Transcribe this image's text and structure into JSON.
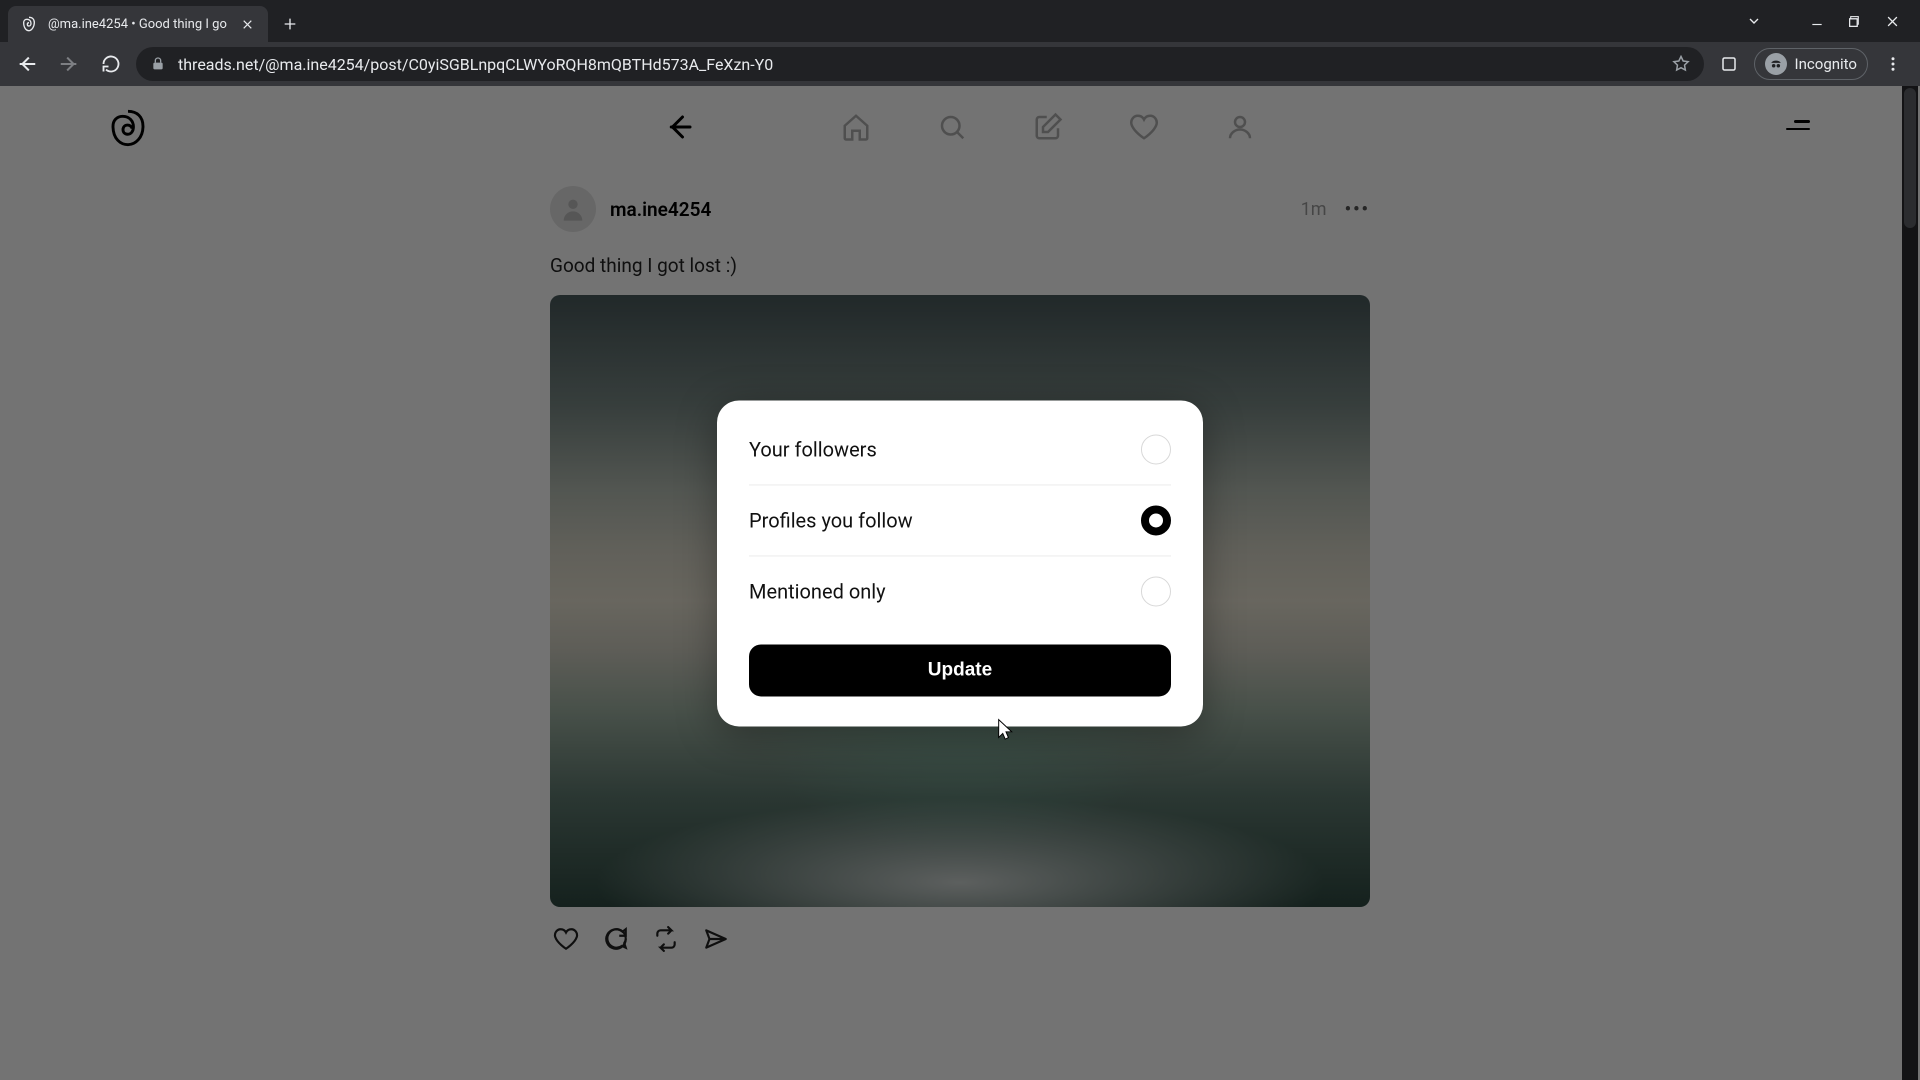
{
  "browser": {
    "tab_title": "@ma.ine4254 • Good thing I go",
    "url": "threads.net/@ma.ine4254/post/C0yiSGBLnpqCLWYoRQH8mQBTHd573A_FeXzn-Y0",
    "incognito_label": "Incognito"
  },
  "post": {
    "username": "ma.ine4254",
    "timestamp": "1m",
    "text": "Good thing I got lost :)"
  },
  "modal": {
    "options": [
      {
        "label": "Your followers",
        "selected": false
      },
      {
        "label": "Profiles you follow",
        "selected": true
      },
      {
        "label": "Mentioned only",
        "selected": false
      }
    ],
    "update_label": "Update"
  }
}
